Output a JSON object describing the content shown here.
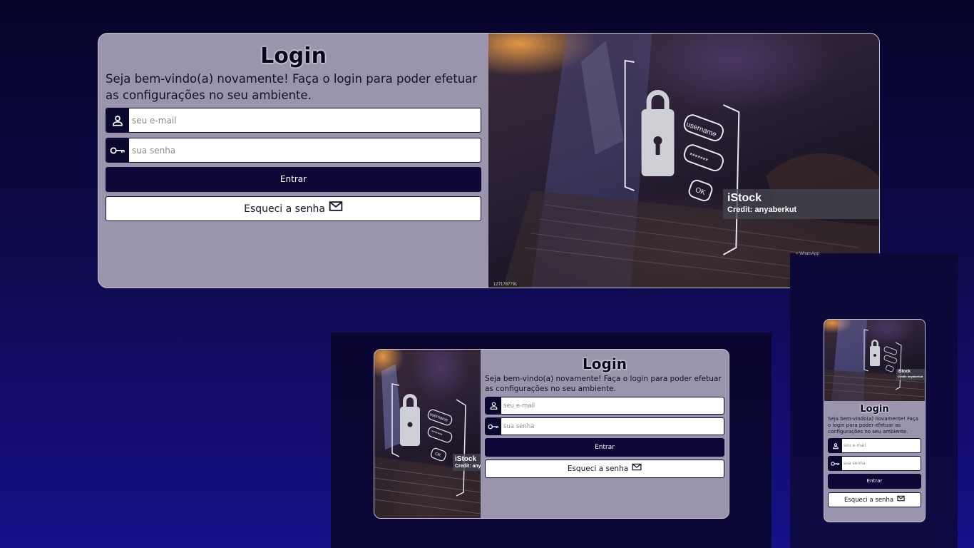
{
  "login": {
    "title": "Login",
    "welcome": "Seja bem-vindo(a) novamente! Faça o login para poder efetuar as configurações no seu ambiente.",
    "email_placeholder": "seu e-mail",
    "password_placeholder": "sua senha",
    "submit_label": "Entrar",
    "forgot_label": "Esqueci a senha",
    "icons": {
      "email_field": "user-icon",
      "password_field": "key-icon",
      "forgot_button": "mail-icon"
    }
  },
  "photo": {
    "watermark_brand": "iStock",
    "watermark_credit": "Credit: anyaberkut",
    "image_id": "1271787791",
    "overlay_labels": [
      "username",
      "*******",
      "OK"
    ]
  },
  "mobile_frame": {
    "top_text": "< WhatsApp"
  },
  "colors": {
    "page_bg": "#0d0a4a",
    "card_bg": "#9a94ac",
    "primary": "#0d0838",
    "input_bg": "#ffffff"
  }
}
